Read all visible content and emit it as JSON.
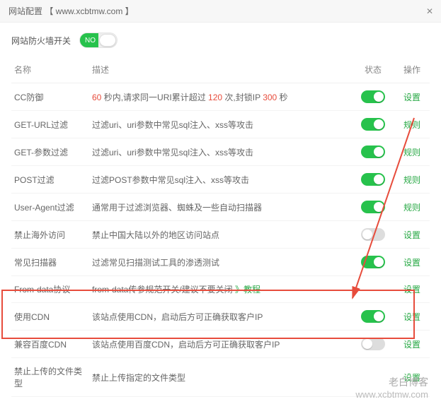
{
  "title": "网站配置 【 www.xcbtmw.com 】",
  "firewall": {
    "label": "网站防火墙开关",
    "on_text": "NO"
  },
  "table": {
    "headers": {
      "name": "名称",
      "desc": "描述",
      "state": "状态",
      "op": "操作"
    },
    "rows": [
      {
        "name": "CC防御",
        "desc_parts": [
          "",
          "60",
          " 秒内,请求同一URI累计超过 ",
          "120",
          " 次,封锁IP ",
          "300",
          " 秒"
        ],
        "state": "on",
        "op": "设置"
      },
      {
        "name": "GET-URL过滤",
        "desc": "过滤uri、uri参数中常见sql注入、xss等攻击",
        "state": "on",
        "op": "规则"
      },
      {
        "name": "GET-参数过滤",
        "desc": "过滤uri、uri参数中常见sql注入、xss等攻击",
        "state": "on",
        "op": "规则"
      },
      {
        "name": "POST过滤",
        "desc": "过滤POST参数中常见sql注入、xss等攻击",
        "state": "on",
        "op": "规则"
      },
      {
        "name": "User-Agent过滤",
        "desc": "通常用于过滤浏览器、蜘蛛及一些自动扫描器",
        "state": "on",
        "op": "规则"
      },
      {
        "name": "禁止海外访问",
        "desc": "禁止中国大陆以外的地区访问站点",
        "state": "off",
        "op": "设置"
      },
      {
        "name": "常见扫描器",
        "desc": "过滤常见扫描测试工具的渗透测试",
        "state": "on",
        "op": "设置"
      },
      {
        "name": "From-data协议",
        "desc": "from-data传参规范开关/建议不要关闭 ",
        "tutorial": "》教程",
        "state": "--",
        "op": "设置"
      },
      {
        "name": "使用CDN",
        "desc": "该站点使用CDN，启动后方可正确获取客户IP",
        "state": "on",
        "op": "设置"
      },
      {
        "name": "兼容百度CDN",
        "desc": "该站点使用百度CDN，启动后方可正确获取客户IP",
        "state": "off",
        "op": "设置"
      },
      {
        "name": "禁止上传的文件类型",
        "desc": "禁止上传指定的文件类型",
        "state": "",
        "op": "设置"
      }
    ]
  },
  "watermark": {
    "line1": "老白博客",
    "line2": "www.xcbtmw.com"
  }
}
